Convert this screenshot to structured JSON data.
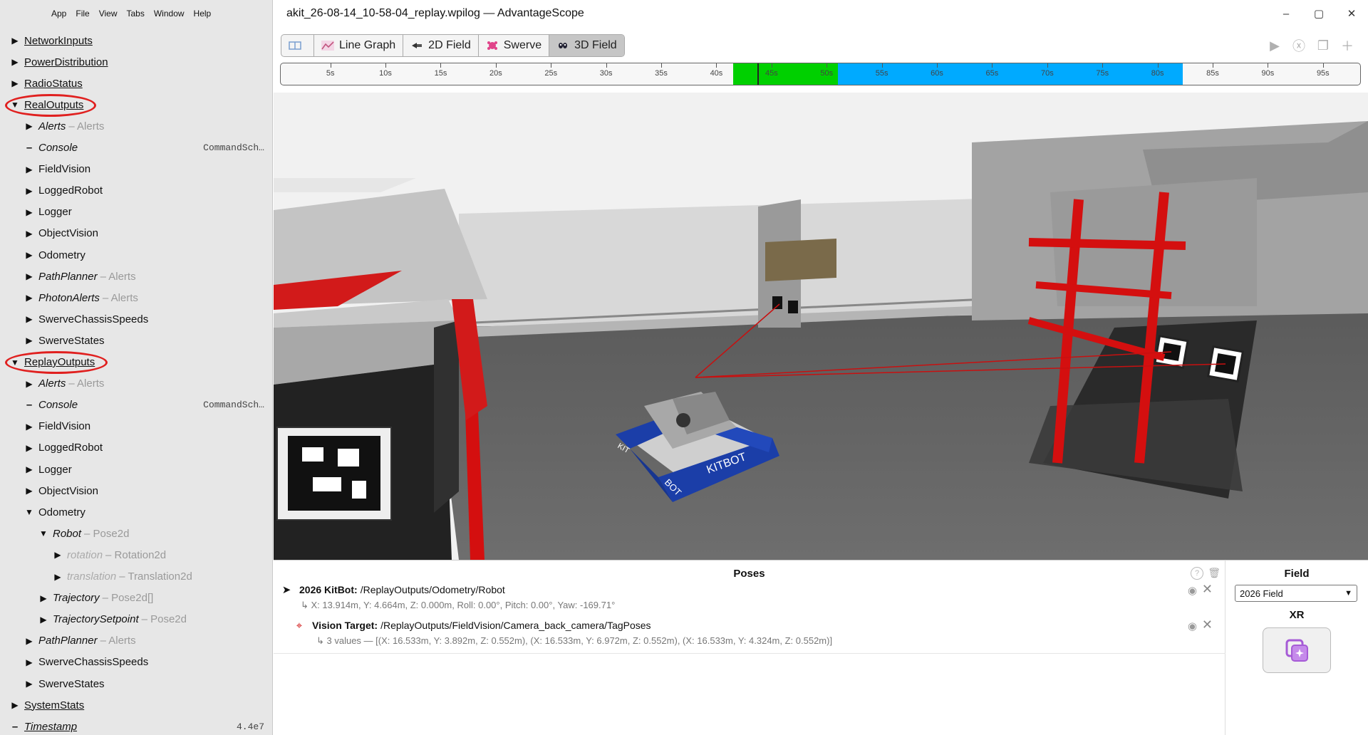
{
  "menu": [
    "App",
    "File",
    "View",
    "Tabs",
    "Window",
    "Help"
  ],
  "window": {
    "title": "akit_26-08-14_10-58-04_replay.wpilog — AdvantageScope",
    "controls": [
      "–",
      "▢",
      "✕"
    ]
  },
  "tabs": [
    {
      "label": "",
      "icon": "book-icon"
    },
    {
      "label": "Line Graph",
      "icon": "line-graph-icon"
    },
    {
      "label": "2D Field",
      "icon": "field-2d-icon"
    },
    {
      "label": "Swerve",
      "icon": "swerve-icon"
    },
    {
      "label": "3D Field",
      "icon": "field-3d-icon",
      "active": true
    }
  ],
  "tab_tools": [
    "play-icon",
    "close-tab-icon",
    "popup-icon",
    "add-tab-icon"
  ],
  "timeline": {
    "ticks": [
      "5s",
      "10s",
      "15s",
      "20s",
      "25s",
      "30s",
      "35s",
      "40s",
      "45s",
      "50s",
      "55s",
      "60s",
      "65s",
      "70s",
      "75s",
      "80s",
      "85s",
      "90s",
      "95s"
    ],
    "start_s": 0.5,
    "end_s": 98.5,
    "green_range": [
      41.5,
      51.0
    ],
    "blue_range": [
      51.0,
      82.3
    ],
    "cursor_s": 43.7,
    "green_color": "#00d000",
    "blue_color": "#00aaff"
  },
  "sidebar": {
    "items": [
      {
        "label": "NetworkInputs",
        "depth": 0,
        "arrow": "▶",
        "underline": true
      },
      {
        "label": "PowerDistribution",
        "depth": 0,
        "arrow": "▶",
        "underline": true
      },
      {
        "label": "RadioStatus",
        "depth": 0,
        "arrow": "▶",
        "underline": true
      },
      {
        "label": "RealOutputs",
        "depth": 0,
        "arrow": "▼",
        "underline": true,
        "circled": true
      },
      {
        "label": "Alerts",
        "depth": 1,
        "arrow": "▶",
        "italic": true,
        "type": "– Alerts"
      },
      {
        "label": "Console",
        "depth": 1,
        "arrow": "–",
        "italic": true,
        "value": "CommandSch…"
      },
      {
        "label": "FieldVision",
        "depth": 1,
        "arrow": "▶"
      },
      {
        "label": "LoggedRobot",
        "depth": 1,
        "arrow": "▶"
      },
      {
        "label": "Logger",
        "depth": 1,
        "arrow": "▶"
      },
      {
        "label": "ObjectVision",
        "depth": 1,
        "arrow": "▶"
      },
      {
        "label": "Odometry",
        "depth": 1,
        "arrow": "▶"
      },
      {
        "label": "PathPlanner",
        "depth": 1,
        "arrow": "▶",
        "italic": true,
        "type": "– Alerts"
      },
      {
        "label": "PhotonAlerts",
        "depth": 1,
        "arrow": "▶",
        "italic": true,
        "type": "– Alerts"
      },
      {
        "label": "SwerveChassisSpeeds",
        "depth": 1,
        "arrow": "▶"
      },
      {
        "label": "SwerveStates",
        "depth": 1,
        "arrow": "▶"
      },
      {
        "label": "ReplayOutputs",
        "depth": 0,
        "arrow": "▼",
        "underline": true,
        "circled": true
      },
      {
        "label": "Alerts",
        "depth": 1,
        "arrow": "▶",
        "italic": true,
        "type": "– Alerts"
      },
      {
        "label": "Console",
        "depth": 1,
        "arrow": "–",
        "italic": true,
        "value": "CommandSch…"
      },
      {
        "label": "FieldVision",
        "depth": 1,
        "arrow": "▶"
      },
      {
        "label": "LoggedRobot",
        "depth": 1,
        "arrow": "▶"
      },
      {
        "label": "Logger",
        "depth": 1,
        "arrow": "▶"
      },
      {
        "label": "ObjectVision",
        "depth": 1,
        "arrow": "▶"
      },
      {
        "label": "Odometry",
        "depth": 1,
        "arrow": "▼"
      },
      {
        "label": "Robot",
        "depth": 2,
        "arrow": "▼",
        "italic": true,
        "type": "– Pose2d"
      },
      {
        "label": "rotation",
        "depth": 3,
        "arrow": "▶",
        "italic": true,
        "grey": true,
        "type": "– Rotation2d"
      },
      {
        "label": "translation",
        "depth": 3,
        "arrow": "▶",
        "italic": true,
        "grey": true,
        "type": "– Translation2d"
      },
      {
        "label": "Trajectory",
        "depth": 2,
        "arrow": "▶",
        "italic": true,
        "type": "– Pose2d[]"
      },
      {
        "label": "TrajectorySetpoint",
        "depth": 2,
        "arrow": "▶",
        "italic": true,
        "type": "– Pose2d"
      },
      {
        "label": "PathPlanner",
        "depth": 1,
        "arrow": "▶",
        "italic": true,
        "type": "– Alerts"
      },
      {
        "label": "SwerveChassisSpeeds",
        "depth": 1,
        "arrow": "▶"
      },
      {
        "label": "SwerveStates",
        "depth": 1,
        "arrow": "▶"
      },
      {
        "label": "SystemStats",
        "depth": 0,
        "arrow": "▶",
        "underline": true
      },
      {
        "label": "Timestamp",
        "depth": 0,
        "arrow": "–",
        "underline": true,
        "italic": true,
        "value": "4.4e7"
      }
    ]
  },
  "poses": {
    "title": "Poses",
    "help": "?",
    "entries": [
      {
        "icon": "arrow-pose-icon",
        "name": "2026 KitBot:",
        "path": "/ReplayOutputs/Odometry/Robot",
        "detail": "↳ X: 13.914m, Y: 4.664m, Z: 0.000m, Roll: 0.00°, Pitch: 0.00°, Yaw: -169.71°"
      },
      {
        "icon": "crosshair-icon",
        "name": "Vision Target:",
        "path": "/ReplayOutputs/FieldVision/Camera_back_camera/TagPoses",
        "detail": "↳ 3 values — [(X: 16.533m, Y: 3.892m, Z: 0.552m), (X: 16.533m, Y: 6.972m, Z: 0.552m), (X: 16.533m, Y: 4.324m, Z: 0.552m)]"
      }
    ]
  },
  "field_panel": {
    "title": "Field",
    "selected": "2026 Field",
    "xr_title": "XR"
  },
  "robot_text": [
    "KITBOT",
    "KIT",
    "BOT"
  ]
}
